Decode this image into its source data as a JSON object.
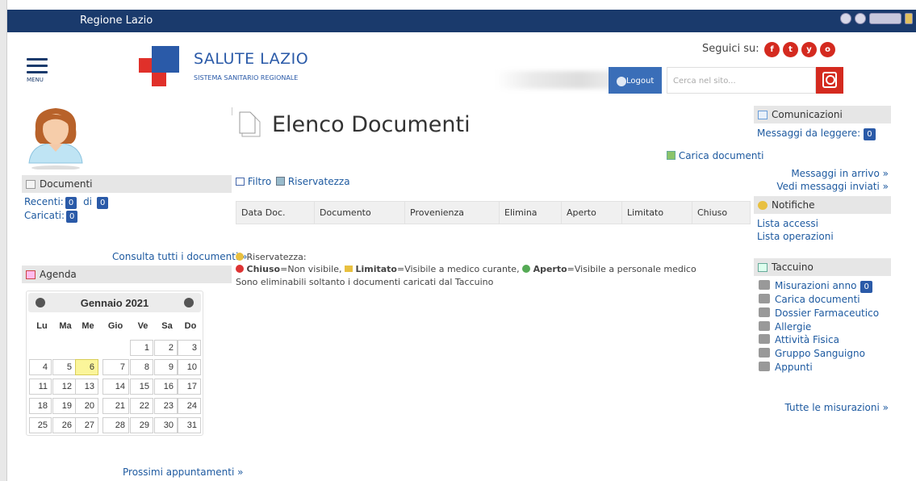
{
  "topbar": {
    "title": "Regione Lazio"
  },
  "header": {
    "menu_label": "MENU",
    "brand": "SALUTE LAZIO",
    "brand_sub": "SISTEMA SANITARIO REGIONALE",
    "seguici": "Seguici su:",
    "logout": "Logout",
    "search_placeholder": "Cerca nel sito..."
  },
  "social": [
    "f",
    "t",
    "y",
    "o"
  ],
  "left": {
    "documenti": {
      "title": "Documenti",
      "recenti_label": "Recenti:",
      "recenti_count": "0",
      "di": "di",
      "total": "0",
      "caricati_label": "Caricati:",
      "caricati_count": "0",
      "consulta": "Consulta tutti i documenti »"
    },
    "agenda": {
      "title": "Agenda",
      "month": "Gennaio 2021",
      "dow": [
        "Lu",
        "Ma",
        "Me",
        "Gio",
        "Ve",
        "Sa",
        "Do"
      ],
      "today": "6",
      "prossimi": "Prossimi appuntamenti »"
    }
  },
  "main": {
    "title": "Elenco Documenti",
    "carica": "Carica documenti",
    "filtro": "Filtro",
    "riservatezza": "Riservatezza",
    "columns": [
      "Data Doc.",
      "Documento",
      "Provenienza",
      "Elimina",
      "Aperto",
      "Limitato",
      "Chiuso"
    ],
    "legend_title": "Riservatezza:",
    "legend": [
      {
        "k": "Chiuso",
        "v": "=Non visibile,"
      },
      {
        "k": "Limitato",
        "v": "=Visibile a medico curante,"
      },
      {
        "k": "Aperto",
        "v": "=Visibile a personale medico"
      }
    ],
    "note": "Sono eliminabili soltanto i documenti caricati dal Taccuino"
  },
  "right": {
    "comunicazioni": {
      "title": "Comunicazioni",
      "messaggi": "Messaggi da leggere:",
      "count": "0",
      "arrivo": "Messaggi in arrivo »",
      "inviati": "Vedi messaggi inviati »"
    },
    "notifiche": {
      "title": "Notifiche",
      "accessi": "Lista accessi",
      "operazioni": "Lista operazioni"
    },
    "taccuino": {
      "title": "Taccuino",
      "items": [
        "Misurazioni anno",
        "Carica documenti",
        "Dossier Farmaceutico",
        "Allergie",
        "Attività Fisica",
        "Gruppo Sanguigno",
        "Appunti"
      ],
      "mis_count": "0",
      "tutte": "Tutte le misurazioni »"
    }
  }
}
